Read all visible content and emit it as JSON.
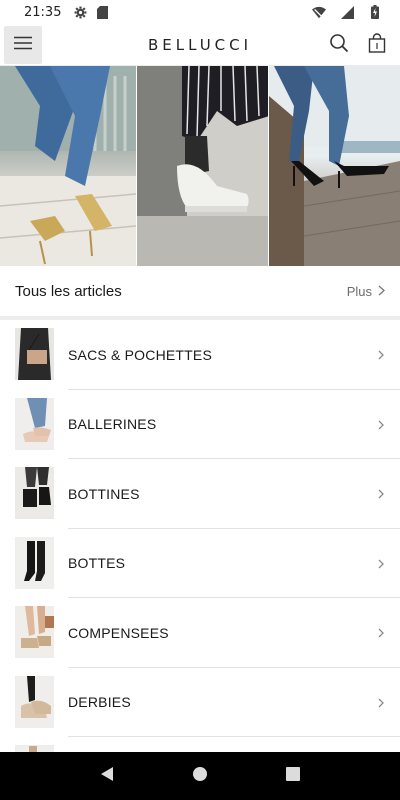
{
  "status_bar": {
    "time": "21:35",
    "icons": [
      "gear-icon",
      "sd-card-icon",
      "wifi-icon",
      "signal-icon",
      "battery-icon"
    ]
  },
  "app_bar": {
    "brand": "BELLUCCI",
    "icons": [
      "menu-icon",
      "search-icon",
      "bag-icon"
    ]
  },
  "hero": {
    "panels": [
      "gold-heels-photo",
      "striped-trousers-sneakers-photo",
      "black-heels-photo"
    ]
  },
  "section": {
    "title": "Tous les articles",
    "more_label": "Plus"
  },
  "categories": [
    {
      "label": "SACS & POCHETTES",
      "thumb": "bag-thumbnail"
    },
    {
      "label": "BALLERINES",
      "thumb": "ballerina-thumbnail"
    },
    {
      "label": "BOTTINES",
      "thumb": "ankle-boot-thumbnail"
    },
    {
      "label": "BOTTES",
      "thumb": "boot-thumbnail"
    },
    {
      "label": "COMPENSEES",
      "thumb": "wedge-thumbnail"
    },
    {
      "label": "DERBIES",
      "thumb": "derby-thumbnail"
    }
  ],
  "colors": {
    "text": "#1a1a1a",
    "muted": "#6d6d6d",
    "divider": "#e2e2e2",
    "nav_bar": "#000000"
  }
}
